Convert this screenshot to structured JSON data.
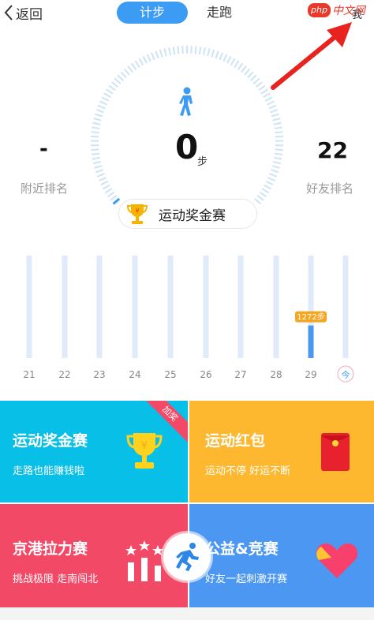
{
  "header": {
    "back_label": "返回",
    "tabs": [
      {
        "label": "计步",
        "active": true
      },
      {
        "label": "走跑",
        "active": false
      }
    ],
    "watermark": {
      "badge": "php",
      "text": "中文网"
    },
    "me_label": "我"
  },
  "stats": {
    "steps_value": "0",
    "steps_unit": "步",
    "nearby_rank_value": "-",
    "nearby_rank_label": "附近排名",
    "friends_rank_value": "22",
    "friends_rank_label": "好友排名",
    "bonus_label": "运动奖金赛"
  },
  "chart_data": {
    "type": "bar",
    "categories": [
      "21",
      "22",
      "23",
      "24",
      "25",
      "26",
      "27",
      "28",
      "29",
      "今"
    ],
    "values": [
      0,
      0,
      0,
      0,
      0,
      0,
      0,
      0,
      1272,
      0
    ],
    "highlight_label": "1272步",
    "highlight_index": 8
  },
  "tiles": [
    {
      "title": "运动奖金赛",
      "subtitle": "走路也能赚钱啦",
      "ribbon": "加奖",
      "icon": "trophy-icon"
    },
    {
      "title": "运动红包",
      "subtitle": "运动不停 好运不断",
      "icon": "red-envelope-icon"
    },
    {
      "title": "京港拉力赛",
      "subtitle": "挑战极限 走南闯北",
      "icon": "podium-stars-icon"
    },
    {
      "title": "公益&竞赛",
      "subtitle": "好友一起刺激开赛",
      "icon": "heart-icon"
    }
  ],
  "colors": {
    "accent": "#3c9bf2",
    "tile_cyan": "#08bfe8",
    "tile_yellow": "#fdb82f",
    "tile_pink": "#f24966",
    "tile_blue": "#4b97f2",
    "bar_bg": "#dfeafa",
    "bar_active": "#4b97f2",
    "badge_orange": "#f5a623"
  }
}
